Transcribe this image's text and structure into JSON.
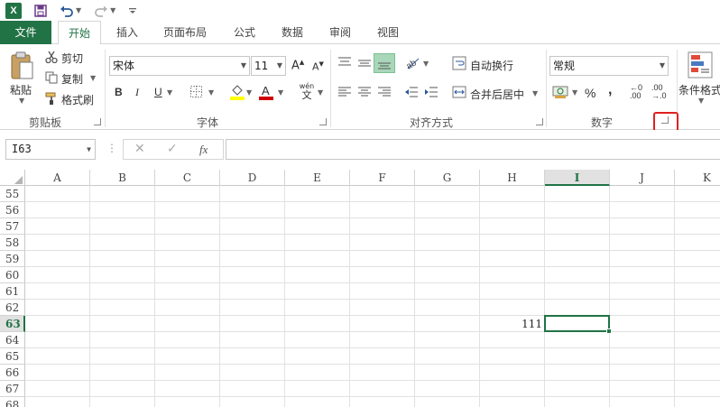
{
  "app": {
    "logo_text": "X"
  },
  "tabs": {
    "file": "文件",
    "home": "开始",
    "insert": "插入",
    "page_layout": "页面布局",
    "formulas": "公式",
    "data": "数据",
    "review": "审阅",
    "view": "视图"
  },
  "clipboard": {
    "paste": "粘贴",
    "cut": "剪切",
    "copy": "复制",
    "format_painter": "格式刷",
    "group_label": "剪贴板"
  },
  "font": {
    "name": "宋体",
    "size": "11",
    "bold": "B",
    "italic": "I",
    "underline": "U",
    "grow": "A",
    "shrink": "A",
    "color_letter": "A",
    "phonetic_top": "wén",
    "phonetic_bottom": "文",
    "group_label": "字体"
  },
  "alignment": {
    "wrap_text": "自动换行",
    "merge_center": "合并后居中",
    "group_label": "对齐方式"
  },
  "number": {
    "format": "常规",
    "percent": "%",
    "comma": ",",
    "inc_decimal_top": "←0",
    "inc_decimal_bottom": ".00",
    "dec_decimal_top": ".00",
    "dec_decimal_bottom": "→.0",
    "group_label": "数字"
  },
  "styles": {
    "conditional_format": "条件格式"
  },
  "formula_bar": {
    "name_box": "I63",
    "cancel": "✕",
    "enter": "✓",
    "fx": "fx",
    "value": ""
  },
  "grid": {
    "columns": [
      "A",
      "B",
      "C",
      "D",
      "E",
      "F",
      "G",
      "H",
      "I",
      "J",
      "K"
    ],
    "rows": [
      "55",
      "56",
      "57",
      "58",
      "59",
      "60",
      "61",
      "62",
      "63",
      "64",
      "65",
      "66",
      "67",
      "68"
    ],
    "selected_column": "I",
    "selected_row": "63",
    "cells": [
      {
        "ref": "H63",
        "value": "111"
      }
    ]
  },
  "colors": {
    "accent": "#217346",
    "highlight": "#e02020"
  }
}
